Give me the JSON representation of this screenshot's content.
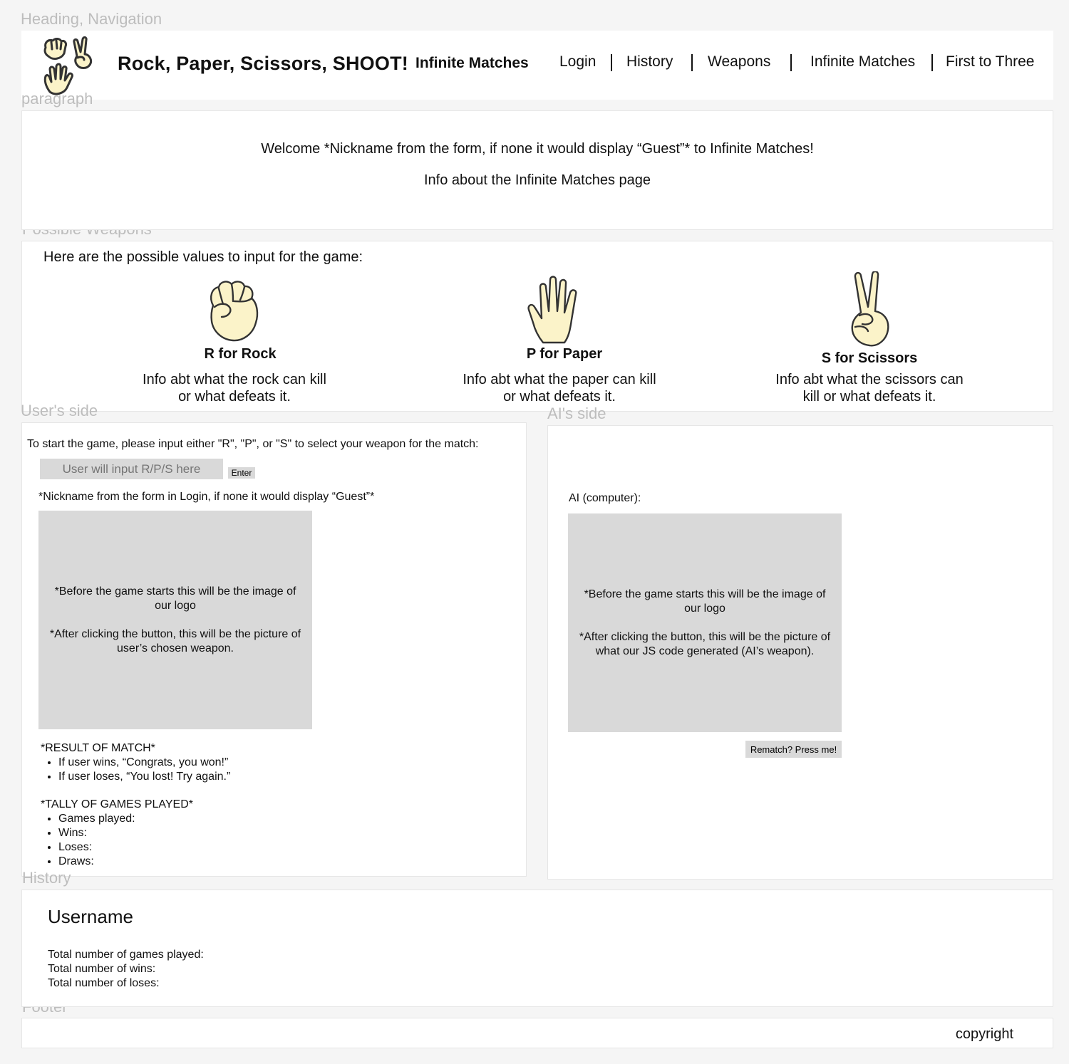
{
  "annotations": {
    "header": "Heading, Navigation",
    "paragraph": "paragraph",
    "weapons": "Possible Weapons",
    "user_side": "User's side",
    "ai_side": "AI's side",
    "history": "History",
    "footer": "Footer"
  },
  "header": {
    "title": "Rock, Paper, Scissors, SHOOT!",
    "current_page": "Infinite Matches",
    "nav": [
      "Login",
      "History",
      "Weapons",
      "Infinite Matches",
      "First to Three"
    ]
  },
  "welcome": {
    "line1": "Welcome *Nickname from the form, if none it would display “Guest”* to Infinite Matches!",
    "line2": "Info about the Infinite Matches page"
  },
  "weapons": {
    "intro": "Here are the possible values to input for the game:",
    "items": [
      {
        "title": "R for Rock",
        "desc": "Info abt what the rock can kill or what defeats it.",
        "icon": "fist-icon"
      },
      {
        "title": "P for Paper",
        "desc": "Info abt what the paper can kill or what defeats it.",
        "icon": "open-hand-icon"
      },
      {
        "title": "S for Scissors",
        "desc": "Info abt what the scissors can kill or what defeats it.",
        "icon": "peace-hand-icon"
      }
    ]
  },
  "user_side": {
    "instructions": "To start the game, please input either \"R\", \"P\", or \"S\" to select your weapon for the match:",
    "input_placeholder": "User will input R/P/S here",
    "enter_label": "Enter",
    "nickname_label": "*Nickname from the form in Login, if none it would display “Guest”*",
    "image_text_1": "*Before the game starts this will be the image of our logo",
    "image_text_2": "*After clicking the button, this will be the picture of user’s chosen weapon.",
    "result_title": "*RESULT OF MATCH*",
    "result_items": [
      "If user wins, “Congrats, you won!”",
      "If user loses, “You lost! Try again.”"
    ],
    "tally_title": "*TALLY OF GAMES PLAYED*",
    "tally_items": [
      "Games played:",
      "Wins:",
      "Loses:",
      "Draws:"
    ]
  },
  "ai_side": {
    "label": "AI (computer):",
    "image_text_1": "*Before the game starts this will be the image of our logo",
    "image_text_2": "*After clicking the button, this will be the picture of what our JS code generated (AI’s weapon).",
    "rematch_label": "Rematch? Press me!"
  },
  "history": {
    "username": "Username",
    "lines": [
      "Total number of games played:",
      "Total number of wins:",
      "Total number of loses:"
    ]
  },
  "footer": {
    "copyright": "copyright"
  }
}
